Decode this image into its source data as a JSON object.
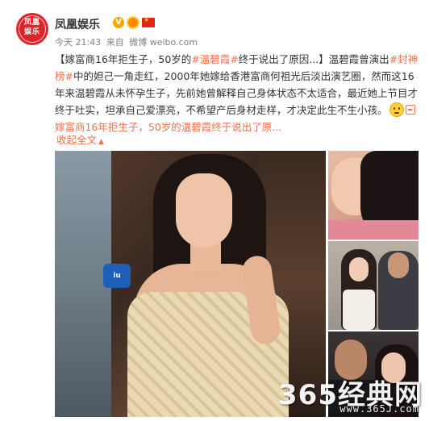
{
  "account": {
    "name": "凤凰娱乐",
    "avatar_text_top": "凤凰",
    "avatar_text_bottom": "娱乐",
    "verified_badge": "V",
    "icons": [
      "verified-badge-icon",
      "medal-icon",
      "china-flag-icon"
    ]
  },
  "meta": {
    "time": "今天 21:43",
    "from_label": "来自",
    "source": "微博 weibo.com"
  },
  "post": {
    "title_open": "【嫁富商16年拒生子，50岁的",
    "tag1": "#温碧霞#",
    "title_close": "终于说出了原因...】温碧霞曾演出",
    "tag2": "#封神榜#",
    "body1": "中的妲己一角走红，2000年她嫁给香港富商何祖光后淡出演艺圈，然而这16年来温碧霞从未怀孕生子，先前她曾解释自己身体状态不太适合，最近她上节目才终于吐实，坦承自己爱漂亮，不希望产后身材走样，才决定此生不生小孩。",
    "link_text": "嫁富商16年拒生子，50岁的温碧霞终于说出了原...",
    "collapse_label": "收起全文",
    "collapse_caret": "▲"
  },
  "photos": {
    "main_band_text": "iu"
  },
  "watermark": {
    "main": "365经典网",
    "sub": "www.365J.com"
  },
  "colors": {
    "link": "#eb7350",
    "text": "#333333",
    "meta": "#808080",
    "avatar_bg": "#d8262a"
  }
}
